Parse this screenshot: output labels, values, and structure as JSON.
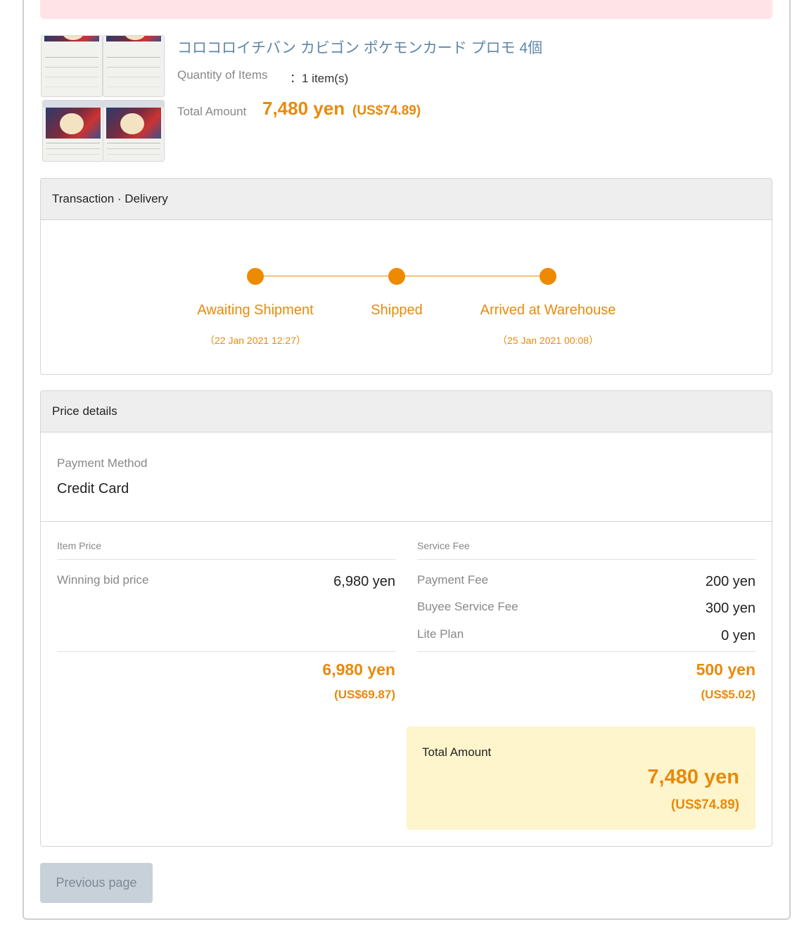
{
  "item": {
    "title": "コロコロイチバン カビゴン ポケモンカード プロモ 4個",
    "quantity_label": "Quantity of Items",
    "quantity_value": "：1 item(s)",
    "total_label": "Total Amount",
    "total_yen": "7,480 yen",
    "total_usd": "(US$74.89)"
  },
  "delivery": {
    "heading": "Transaction · Delivery",
    "steps": [
      {
        "label": "Awaiting Shipment",
        "date": "（22 Jan 2021 12:27）"
      },
      {
        "label": "Shipped",
        "date": ""
      },
      {
        "label": "Arrived at Warehouse",
        "date": "（25 Jan 2021 00:08）"
      }
    ]
  },
  "price": {
    "heading": "Price details",
    "payment_method_label": "Payment Method",
    "payment_method_value": "Credit Card",
    "item_price": {
      "heading": "Item Price",
      "rows": [
        {
          "label": "Winning bid price",
          "value": "6,980 yen"
        }
      ],
      "subtotal_yen": "6,980 yen",
      "subtotal_usd": "(US$69.87)"
    },
    "service_fee": {
      "heading": "Service Fee",
      "rows": [
        {
          "label": "Payment Fee",
          "value": "200 yen"
        },
        {
          "label": "Buyee Service Fee",
          "value": "300 yen"
        },
        {
          "label": "Lite Plan",
          "value": "0 yen"
        }
      ],
      "subtotal_yen": "500 yen",
      "subtotal_usd": "(US$5.02)"
    },
    "total": {
      "label": "Total Amount",
      "yen": "7,480 yen",
      "usd": "(US$74.89)"
    }
  },
  "buttons": {
    "previous_page": "Previous page"
  },
  "colors": {
    "accent": "#e88a0c",
    "link": "#5f87a8",
    "total_bg": "#fff5cc",
    "alert_bg": "#ffe3e6"
  }
}
